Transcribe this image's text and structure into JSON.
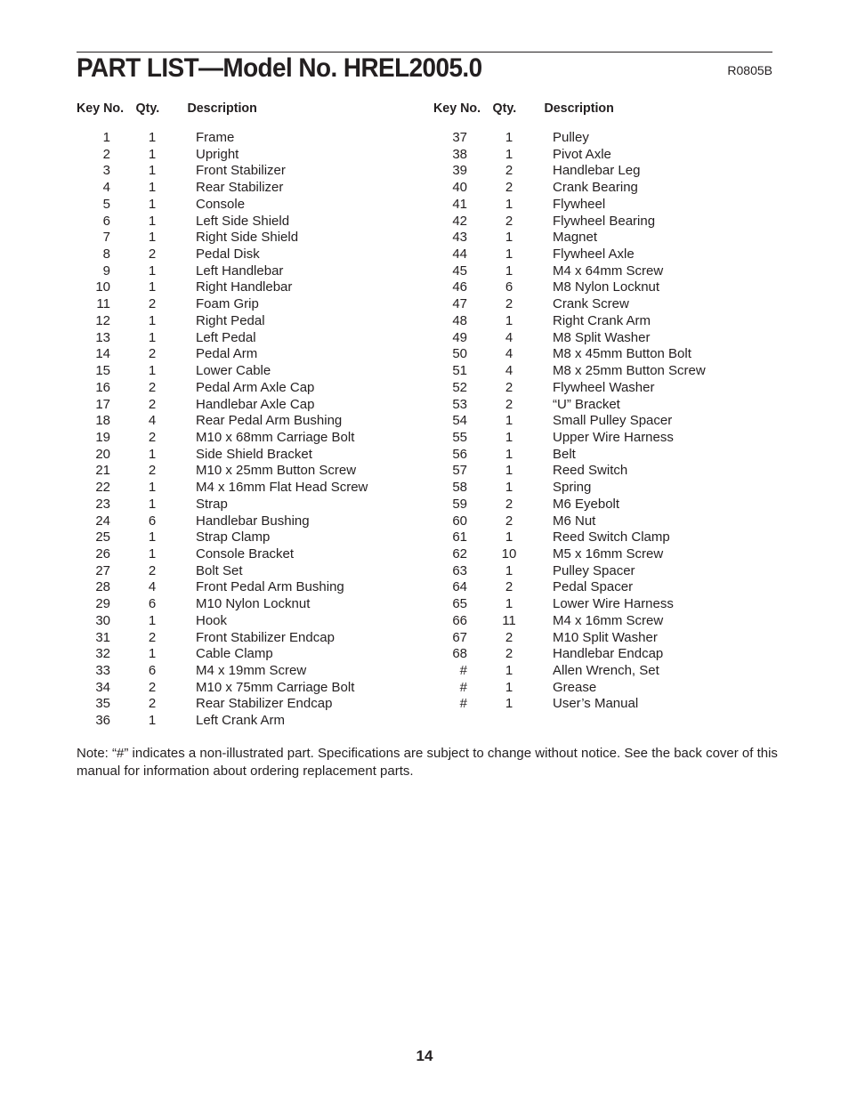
{
  "header": {
    "title": "PART LIST—Model No. HREL2005.0",
    "code": "R0805B"
  },
  "columns": {
    "key_label": "Key No.",
    "qty_label": "Qty.",
    "desc_label": "Description"
  },
  "left_parts": [
    {
      "key": "1",
      "qty": "1",
      "desc": "Frame"
    },
    {
      "key": "2",
      "qty": "1",
      "desc": "Upright"
    },
    {
      "key": "3",
      "qty": "1",
      "desc": "Front Stabilizer"
    },
    {
      "key": "4",
      "qty": "1",
      "desc": "Rear Stabilizer"
    },
    {
      "key": "5",
      "qty": "1",
      "desc": "Console"
    },
    {
      "key": "6",
      "qty": "1",
      "desc": "Left Side Shield"
    },
    {
      "key": "7",
      "qty": "1",
      "desc": "Right Side Shield"
    },
    {
      "key": "8",
      "qty": "2",
      "desc": "Pedal Disk"
    },
    {
      "key": "9",
      "qty": "1",
      "desc": "Left Handlebar"
    },
    {
      "key": "10",
      "qty": "1",
      "desc": "Right Handlebar"
    },
    {
      "key": "11",
      "qty": "2",
      "desc": "Foam Grip"
    },
    {
      "key": "12",
      "qty": "1",
      "desc": "Right Pedal"
    },
    {
      "key": "13",
      "qty": "1",
      "desc": "Left Pedal"
    },
    {
      "key": "14",
      "qty": "2",
      "desc": "Pedal Arm"
    },
    {
      "key": "15",
      "qty": "1",
      "desc": "Lower Cable"
    },
    {
      "key": "16",
      "qty": "2",
      "desc": "Pedal Arm Axle Cap"
    },
    {
      "key": "17",
      "qty": "2",
      "desc": "Handlebar Axle Cap"
    },
    {
      "key": "18",
      "qty": "4",
      "desc": "Rear Pedal Arm Bushing"
    },
    {
      "key": "19",
      "qty": "2",
      "desc": "M10 x 68mm Carriage Bolt"
    },
    {
      "key": "20",
      "qty": "1",
      "desc": "Side Shield Bracket"
    },
    {
      "key": "21",
      "qty": "2",
      "desc": "M10 x 25mm Button Screw"
    },
    {
      "key": "22",
      "qty": "1",
      "desc": "M4 x 16mm Flat Head Screw"
    },
    {
      "key": "23",
      "qty": "1",
      "desc": "Strap"
    },
    {
      "key": "24",
      "qty": "6",
      "desc": "Handlebar Bushing"
    },
    {
      "key": "25",
      "qty": "1",
      "desc": "Strap Clamp"
    },
    {
      "key": "26",
      "qty": "1",
      "desc": "Console Bracket"
    },
    {
      "key": "27",
      "qty": "2",
      "desc": "Bolt Set"
    },
    {
      "key": "28",
      "qty": "4",
      "desc": "Front Pedal Arm Bushing"
    },
    {
      "key": "29",
      "qty": "6",
      "desc": "M10 Nylon Locknut"
    },
    {
      "key": "30",
      "qty": "1",
      "desc": "Hook"
    },
    {
      "key": "31",
      "qty": "2",
      "desc": "Front Stabilizer Endcap"
    },
    {
      "key": "32",
      "qty": "1",
      "desc": "Cable Clamp"
    },
    {
      "key": "33",
      "qty": "6",
      "desc": "M4 x 19mm Screw"
    },
    {
      "key": "34",
      "qty": "2",
      "desc": "M10 x 75mm Carriage Bolt"
    },
    {
      "key": "35",
      "qty": "2",
      "desc": "Rear Stabilizer Endcap"
    },
    {
      "key": "36",
      "qty": "1",
      "desc": "Left Crank Arm"
    }
  ],
  "right_parts": [
    {
      "key": "37",
      "qty": "1",
      "desc": "Pulley"
    },
    {
      "key": "38",
      "qty": "1",
      "desc": "Pivot Axle"
    },
    {
      "key": "39",
      "qty": "2",
      "desc": "Handlebar Leg"
    },
    {
      "key": "40",
      "qty": "2",
      "desc": "Crank Bearing"
    },
    {
      "key": "41",
      "qty": "1",
      "desc": "Flywheel"
    },
    {
      "key": "42",
      "qty": "2",
      "desc": "Flywheel Bearing"
    },
    {
      "key": "43",
      "qty": "1",
      "desc": "Magnet"
    },
    {
      "key": "44",
      "qty": "1",
      "desc": "Flywheel Axle"
    },
    {
      "key": "45",
      "qty": "1",
      "desc": "M4 x 64mm Screw"
    },
    {
      "key": "46",
      "qty": "6",
      "desc": "M8 Nylon Locknut"
    },
    {
      "key": "47",
      "qty": "2",
      "desc": "Crank Screw"
    },
    {
      "key": "48",
      "qty": "1",
      "desc": "Right Crank Arm"
    },
    {
      "key": "49",
      "qty": "4",
      "desc": "M8 Split Washer"
    },
    {
      "key": "50",
      "qty": "4",
      "desc": "M8 x 45mm Button Bolt"
    },
    {
      "key": "51",
      "qty": "4",
      "desc": "M8 x 25mm Button Screw"
    },
    {
      "key": "52",
      "qty": "2",
      "desc": "Flywheel Washer"
    },
    {
      "key": "53",
      "qty": "2",
      "desc": "“U” Bracket"
    },
    {
      "key": "54",
      "qty": "1",
      "desc": "Small Pulley Spacer"
    },
    {
      "key": "55",
      "qty": "1",
      "desc": "Upper Wire Harness"
    },
    {
      "key": "56",
      "qty": "1",
      "desc": "Belt"
    },
    {
      "key": "57",
      "qty": "1",
      "desc": "Reed Switch"
    },
    {
      "key": "58",
      "qty": "1",
      "desc": "Spring"
    },
    {
      "key": "59",
      "qty": "2",
      "desc": "M6 Eyebolt"
    },
    {
      "key": "60",
      "qty": "2",
      "desc": "M6 Nut"
    },
    {
      "key": "61",
      "qty": "1",
      "desc": "Reed Switch Clamp"
    },
    {
      "key": "62",
      "qty": "10",
      "desc": "M5 x 16mm Screw"
    },
    {
      "key": "63",
      "qty": "1",
      "desc": "Pulley Spacer"
    },
    {
      "key": "64",
      "qty": "2",
      "desc": "Pedal Spacer"
    },
    {
      "key": "65",
      "qty": "1",
      "desc": "Lower Wire Harness"
    },
    {
      "key": "66",
      "qty": "11",
      "desc": "M4 x 16mm Screw"
    },
    {
      "key": "67",
      "qty": "2",
      "desc": "M10 Split Washer"
    },
    {
      "key": "68",
      "qty": "2",
      "desc": "Handlebar Endcap"
    },
    {
      "key": "#",
      "qty": "1",
      "desc": "Allen Wrench, Set"
    },
    {
      "key": "#",
      "qty": "1",
      "desc": "Grease"
    },
    {
      "key": "#",
      "qty": "1",
      "desc": "User’s Manual"
    }
  ],
  "note": "Note: “#” indicates a non-illustrated part. Specifications are subject to change without notice. See the back cover of this manual for information about ordering replacement parts.",
  "page_number": "14"
}
